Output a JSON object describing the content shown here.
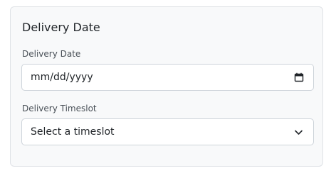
{
  "section": {
    "title": "Delivery Date"
  },
  "delivery_date": {
    "label": "Delivery Date",
    "value": "mm/dd/yyyy",
    "icon": "calendar-icon"
  },
  "delivery_timeslot": {
    "label": "Delivery Timeslot",
    "selected": "Select a timeslot",
    "icon": "chevron-down-icon"
  },
  "colors": {
    "card_background": "#f8f9fa",
    "card_border": "#dfe2e6",
    "input_border": "#ced4da",
    "text": "#212529",
    "label": "#495057"
  }
}
